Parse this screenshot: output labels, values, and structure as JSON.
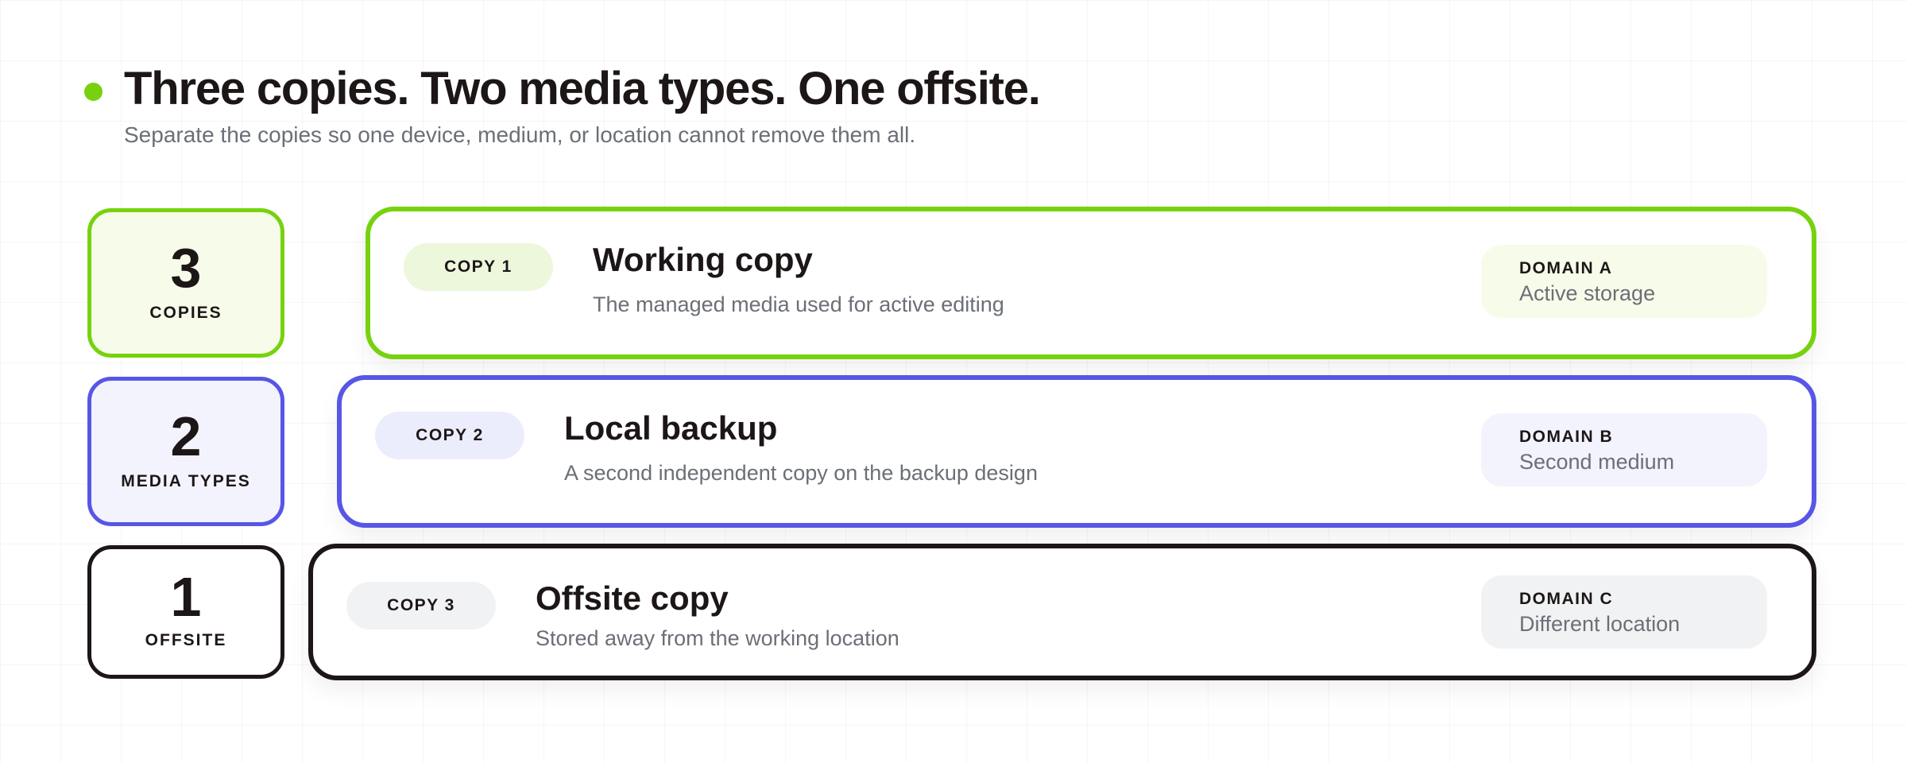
{
  "header": {
    "title": "Three copies. Two media types. One offsite.",
    "subtitle": "Separate the copies so one device, medium, or location cannot remove them all.",
    "accent_color": "#76d20f"
  },
  "stats": [
    {
      "number": "3",
      "label": "COPIES",
      "border_color": "#76d20f",
      "bg_color": "#f6fce9"
    },
    {
      "number": "2",
      "label": "MEDIA TYPES",
      "border_color": "#5856e6",
      "bg_color": "#f3f3fe"
    },
    {
      "number": "1",
      "label": "OFFSITE",
      "border_color": "#1d1617",
      "bg_color": "#ffffff"
    }
  ],
  "copies": [
    {
      "pill": "COPY 1",
      "title": "Working copy",
      "description": "The managed media used for active editing",
      "domain_label": "DOMAIN A",
      "domain_value": "Active storage",
      "border_color": "#76d20f",
      "pill_bg": "#ecf7dc",
      "domain_bg": "#f6fce9"
    },
    {
      "pill": "COPY 2",
      "title": "Local backup",
      "description": "A second independent copy on the backup design",
      "domain_label": "DOMAIN B",
      "domain_value": "Second medium",
      "border_color": "#5856e6",
      "pill_bg": "#ecedfc",
      "domain_bg": "#f3f3fe"
    },
    {
      "pill": "COPY 3",
      "title": "Offsite copy",
      "description": "Stored away from the working location",
      "domain_label": "DOMAIN C",
      "domain_value": "Different location",
      "border_color": "#1d1617",
      "pill_bg": "#f1f2f4",
      "domain_bg": "#f1f2f4"
    }
  ]
}
